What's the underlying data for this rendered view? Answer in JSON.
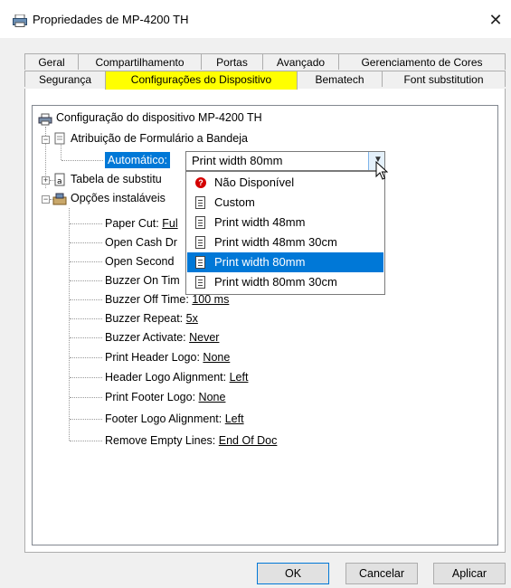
{
  "window": {
    "title": "Propriedades de MP-4200 TH",
    "close_glyph": "✕"
  },
  "tabs": {
    "row1": [
      "Geral",
      "Compartilhamento",
      "Portas",
      "Avançado",
      "Gerenciamento de Cores"
    ],
    "row2": [
      "Segurança",
      "Configurações do Dispositivo",
      "Bematech",
      "Font substitution"
    ],
    "selected": "Configurações do Dispositivo"
  },
  "tree": {
    "root": "Configuração do dispositivo MP-4200 TH",
    "form_assign": "Atribuição de Formulário a Bandeja",
    "auto_label": "Automático:",
    "font_table": "Tabela de substitu",
    "options": "Opções instaláveis",
    "items": [
      {
        "name": "Paper Cut:",
        "value": "Ful"
      },
      {
        "name": "Open Cash Dr",
        "value": ""
      },
      {
        "name": "Open Second",
        "value": ""
      },
      {
        "name": "Buzzer On Tim",
        "value": ""
      },
      {
        "name": "Buzzer Off Time:",
        "value": "100 ms"
      },
      {
        "name": "Buzzer Repeat:",
        "value": "5x"
      },
      {
        "name": "Buzzer Activate:",
        "value": "Never"
      },
      {
        "name": "Print Header Logo:",
        "value": "None"
      },
      {
        "name": "Header Logo Alignment:",
        "value": "Left"
      },
      {
        "name": "Print Footer Logo:",
        "value": "None"
      },
      {
        "name": "Footer Logo Alignment:",
        "value": "Left"
      },
      {
        "name": "Remove Empty Lines:",
        "value": "End Of Doc"
      }
    ]
  },
  "combo": {
    "value": "Print width 80mm"
  },
  "dropdown": {
    "options": [
      "Não Disponível",
      "Custom",
      "Print width 48mm",
      "Print width 48mm 30cm",
      "Print width 80mm",
      "Print width 80mm 30cm"
    ],
    "highlighted": "Print width 80mm"
  },
  "buttons": {
    "ok": "OK",
    "cancel": "Cancelar",
    "apply": "Aplicar"
  },
  "colors": {
    "selection": "#0078d7",
    "tab_highlight": "#ffff00"
  }
}
